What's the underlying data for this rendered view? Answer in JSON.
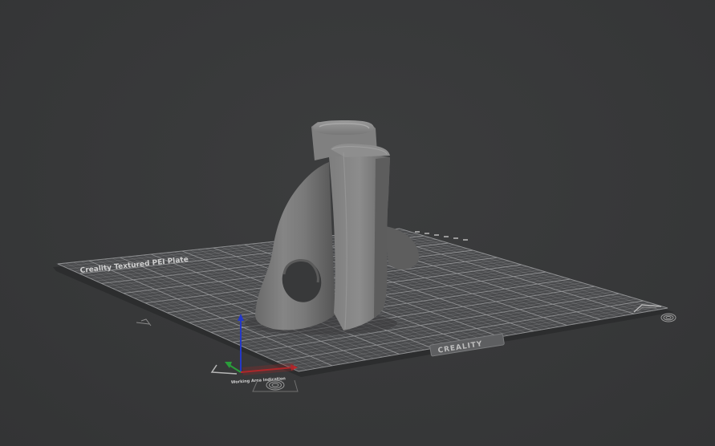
{
  "viewport": {
    "background": "#38393a"
  },
  "bed": {
    "title": "Creality Textured PEI Plate",
    "brand": "CREALITY",
    "origin_label": "Working Area Indication",
    "surface_color": "#4a4b4d",
    "grid_color": "#9a9b9d",
    "edge_color": "#2c2d2e"
  },
  "model": {
    "color": "#6e6e6e"
  },
  "axes": {
    "x_color": "#c0262a",
    "y_color": "#2a9d3a",
    "z_color": "#2438c8"
  },
  "icons": {
    "fingerprint_front": "fingerprint-icon",
    "fingerprint_right": "fingerprint-icon",
    "corner_marker": "corner-marker-icon"
  }
}
